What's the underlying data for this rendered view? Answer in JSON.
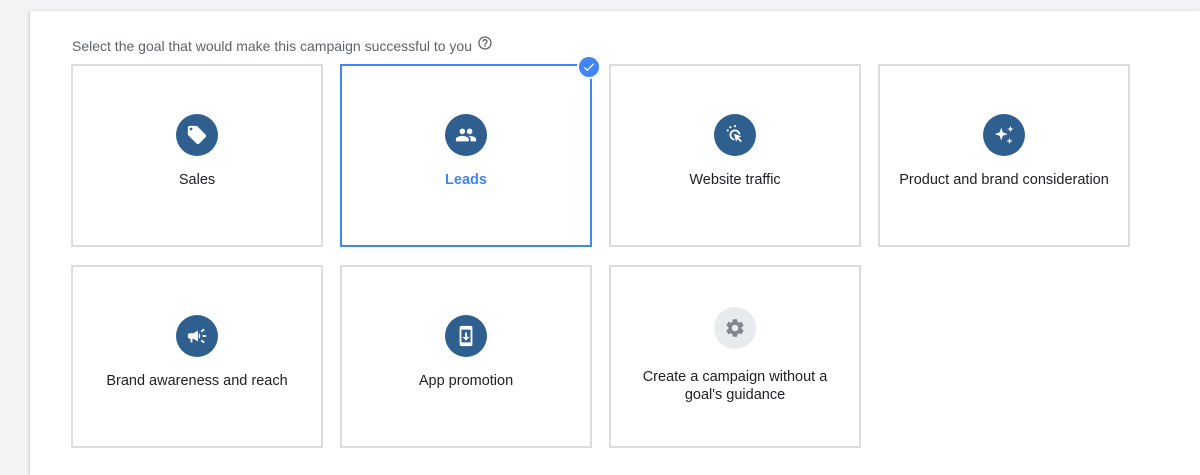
{
  "prompt": {
    "text": "Select the goal that would make this campaign successful to you",
    "help_icon": "help-circle-icon"
  },
  "goals": [
    {
      "label": "Sales",
      "icon": "tag-icon",
      "selected": false
    },
    {
      "label": "Leads",
      "icon": "people-icon",
      "selected": true
    },
    {
      "label": "Website traffic",
      "icon": "cursor-click-icon",
      "selected": false
    },
    {
      "label": "Product and brand consideration",
      "icon": "sparkle-icon",
      "selected": false
    },
    {
      "label": "Brand awareness and reach",
      "icon": "megaphone-icon",
      "selected": false
    },
    {
      "label": "App promotion",
      "icon": "phone-download-icon",
      "selected": false
    },
    {
      "label": "Create a campaign without a goal's guidance",
      "icon": "gear-icon",
      "selected": false
    }
  ],
  "colors": {
    "accent": "#4285f4",
    "icon_circle": "#2f5f8f",
    "icon_circle_neutral": "#e8eaed",
    "card_border": "#dadce0"
  }
}
